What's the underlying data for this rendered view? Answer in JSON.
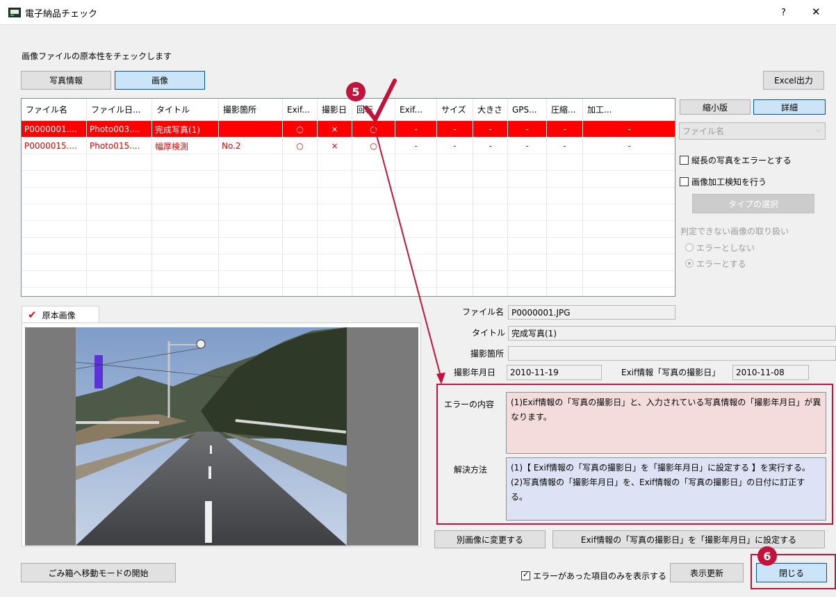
{
  "window": {
    "title": "電子納品チェック",
    "help": "?",
    "close": "✕"
  },
  "description": "画像ファイルの原本性をチェックします",
  "tabs": {
    "photo_info": "写真情報",
    "image": "画像"
  },
  "excel_button": "Excel出力",
  "view_buttons": {
    "thumbnail": "縮小版",
    "detail": "詳細"
  },
  "sort_select": "ファイル名",
  "options": {
    "portrait_error": "縦長の写真をエラーとする",
    "detect_processing": "画像加工検知を行う",
    "type_select": "タイプの選択",
    "undetermined_label": "判定できない画像の取り扱い",
    "radio_no_error": "エラーとしない",
    "radio_error": "エラーとする"
  },
  "table": {
    "headers": [
      "ファイル名",
      "ファイル日...",
      "タイトル",
      "撮影箇所",
      "Exif...",
      "撮影日",
      "回転",
      "Exif...",
      "サイズ",
      "大きさ",
      "GPS...",
      "圧縮...",
      "加工..."
    ],
    "rows": [
      [
        "P0000001....",
        "Photo003....",
        "完成写真(1)",
        "",
        "○",
        "×",
        "○",
        "-",
        "-",
        "-",
        "-",
        "-",
        "-"
      ],
      [
        "P0000015....",
        "Photo015....",
        "幅厚検測",
        "No.2",
        "○",
        "×",
        "○",
        "-",
        "-",
        "-",
        "-",
        "-",
        "-"
      ]
    ]
  },
  "original_tab": "原本画像",
  "details": {
    "file_label": "ファイル名",
    "file_value": "P0000001.JPG",
    "title_label": "タイトル",
    "title_value": "完成写真(1)",
    "location_label": "撮影箇所",
    "location_value": "",
    "date_label": "撮影年月日",
    "date_value": "2010-11-19",
    "exif_label": "Exif情報「写真の撮影日」",
    "exif_value": "2010-11-08",
    "error_label": "エラーの内容",
    "error_text": "(1)Exif情報の「写真の撮影日」と、入力されている写真情報の「撮影年月日」が異なります。",
    "solution_label": "解決方法",
    "solution_text_1": "(1)【 Exif情報の「写真の撮影日」を「撮影年月日」に設定する 】を実行する。",
    "solution_text_2": "(2)写真情報の「撮影年月日」を、Exif情報の「写真の撮影日」の日付に訂正する。"
  },
  "buttons": {
    "change_image": "別画像に変更する",
    "set_exif_date": "Exif情報の「写真の撮影日」を「撮影年月日」に設定する",
    "trash_mode": "ごみ箱へ移動モードの開始",
    "show_errors_only": "エラーがあった項目のみを表示する",
    "refresh": "表示更新",
    "close": "閉じる"
  },
  "markers": {
    "step5": "5",
    "step6": "6"
  },
  "colors": {
    "selected_row": "#ff0000",
    "error_text": "#e00000",
    "annotation": "#c0143c",
    "error_bg": "#f5dcdc",
    "solution_bg": "#dde3f5"
  }
}
